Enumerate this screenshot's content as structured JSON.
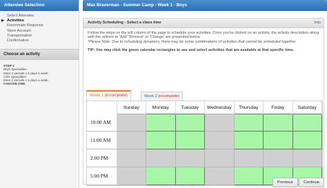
{
  "sidebar": {
    "title": "Attendee Selection",
    "nav": [
      {
        "label": "Select Attendee",
        "active": false
      },
      {
        "label": "Activities",
        "active": true
      },
      {
        "label": "Roommate Requests",
        "active": false
      },
      {
        "label": "Store Account",
        "active": false
      },
      {
        "label": "Transportation",
        "active": false
      },
      {
        "label": "Confirmation",
        "active": false
      }
    ],
    "section_title": "Choose an activity",
    "step_lines": [
      "STEP 2",
      "Boys Specialties:",
      "Meet 3 periods x 5 days a week.",
      "Girls Specialties:",
      "Meet 2 periods x 5 days a week.",
      "CHOOSE ONE."
    ]
  },
  "main": {
    "title": "Max Braverman - Summer Camp - Week 1 - Boys",
    "panel_title": "Activity Scheduling - Select a class time",
    "help": "help",
    "instructions": "Follow the steps on the left column of the page to schedule your activities. Once you've clicked on an activity, the activity description along with the options to 'Add' 'Remove' or 'Change' are presented below.",
    "note": "*Please Note: Due to scheduling dynamics, there may be some combinations of activities that cannot be scheduled together.",
    "tip": "TIP:  You may click the green calendar rectangles to see and select activities that are available at that specific time.",
    "tabs": [
      {
        "label": "Week 1",
        "status": "(incomplete)",
        "active": true
      },
      {
        "label": "Week 2",
        "status": "(incomplete)",
        "active": false
      }
    ],
    "days": [
      "Sunday",
      "Monday",
      "Tuesday",
      "Wednesday",
      "Thursday",
      "Friday",
      "Saturday"
    ],
    "times": [
      "10:00 AM",
      "11:00 AM",
      "2:00 PM",
      "5:00 PM"
    ],
    "available": [
      [
        false,
        true,
        true,
        false,
        true,
        true,
        true
      ],
      [
        false,
        true,
        true,
        false,
        true,
        true,
        true
      ],
      [
        false,
        false,
        false,
        false,
        false,
        false,
        false
      ],
      [
        false,
        true,
        true,
        false,
        true,
        true,
        true
      ]
    ]
  },
  "buttons": {
    "previous": "Previous",
    "continue": "Continue"
  },
  "colors": {
    "header_blue": "#2f6fb3",
    "available_green": "#a8f7a8",
    "unavailable_gray": "#d0d0d0",
    "incomplete_red": "#d12a2a"
  }
}
